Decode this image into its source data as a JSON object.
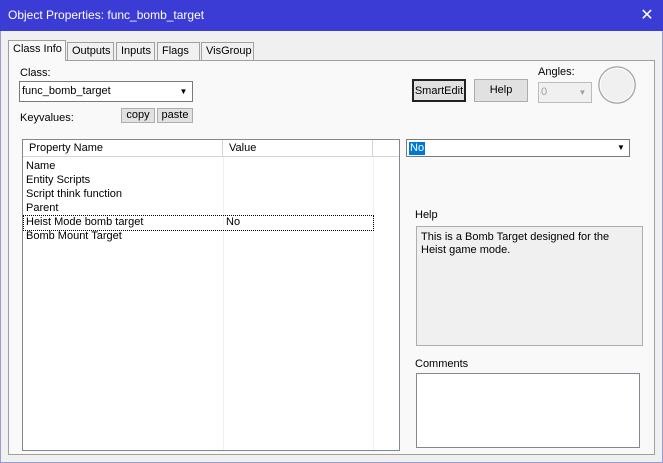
{
  "window": {
    "title": "Object Properties: func_bomb_target",
    "close_glyph": "✕"
  },
  "tabs": [
    {
      "label": "Class Info",
      "active": true
    },
    {
      "label": "Outputs",
      "active": false
    },
    {
      "label": "Inputs",
      "active": false
    },
    {
      "label": "Flags",
      "active": false
    },
    {
      "label": "VisGroup",
      "active": false
    }
  ],
  "class_info": {
    "class_label": "Class:",
    "class_value": "func_bomb_target",
    "keyvalues_label": "Keyvalues:",
    "copy_label": "copy",
    "paste_label": "paste",
    "smartedit_label": "SmartEdit",
    "help_label": "Help",
    "angles_label": "Angles:",
    "angles_value": "0"
  },
  "grid": {
    "headers": [
      "Property Name",
      "Value"
    ],
    "rows": [
      {
        "name": "Name",
        "value": ""
      },
      {
        "name": "Entity Scripts",
        "value": ""
      },
      {
        "name": "Script think function",
        "value": ""
      },
      {
        "name": "Parent",
        "value": ""
      },
      {
        "name": "Heist Mode bomb target",
        "value": "No"
      },
      {
        "name": "Bomb Mount Target",
        "value": ""
      }
    ]
  },
  "value_select": {
    "selected": "No"
  },
  "help_panel": {
    "label": "Help",
    "text": "This is a Bomb Target designed for the Heist game mode."
  },
  "comments_panel": {
    "label": "Comments",
    "text": ""
  },
  "colors": {
    "titlebar": "#3b3bd6",
    "selection": "#0078d7"
  }
}
